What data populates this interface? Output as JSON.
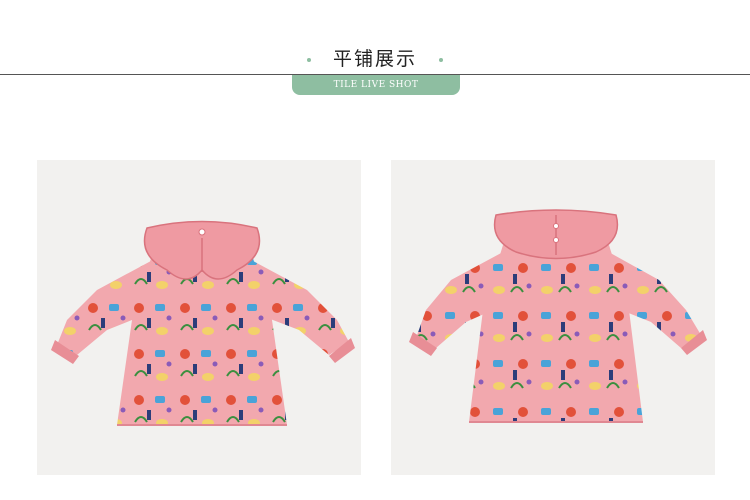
{
  "header": {
    "title": "平铺展示",
    "subtitle": "TILE LIVE SHOT",
    "accent_color": "#8ebea1",
    "dot_color": "#8ebea1"
  },
  "photos": [
    {
      "name": "front-view",
      "icon": "dress-front-image",
      "dress_color": "#f2a8ae"
    },
    {
      "name": "back-view",
      "icon": "dress-back-image",
      "dress_color": "#f2a8ae"
    }
  ]
}
